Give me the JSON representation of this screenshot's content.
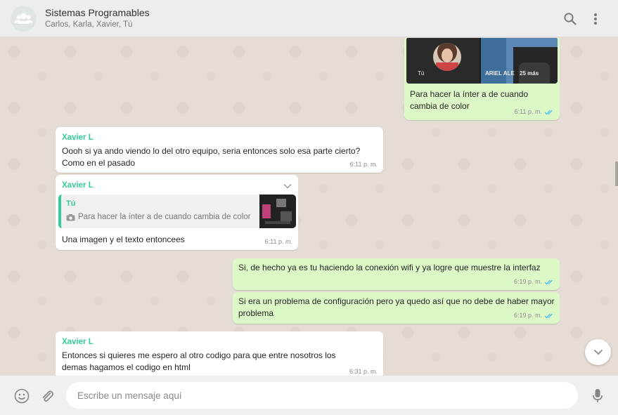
{
  "header": {
    "title": "Sistemas Programables",
    "members": "Carlos, Karla, Xavier, Tú"
  },
  "messages": {
    "m0": {
      "video_tiles": [
        "Tú",
        "ARIEL ALE",
        "25 más"
      ],
      "text": "Para hacer la ínter a de cuando cambia de color",
      "time": "6:11 p. m."
    },
    "m1": {
      "sender": "Xavier L",
      "text": "Oooh si ya ando viendo lo del otro equipo, seria entonces solo esa parte cierto? Como en el pasado",
      "time": "6:11 p. m."
    },
    "m2": {
      "sender": "Xavier L",
      "quote_author": "Tú",
      "quote_text": "Para hacer la ínter a de cuando cambia de color",
      "text": "Una imagen y el texto entoncees",
      "time": "6:11 p. m."
    },
    "m3": {
      "text": "Si, de hecho ya es tu haciendo la conexión wifi y ya logre que muestre la interfaz",
      "time": "6:19 p. m."
    },
    "m4": {
      "text": "Si era un problema de configuración pero ya quedo así que no debe de haber mayor problema",
      "time": "6:19 p. m."
    },
    "m5": {
      "sender": "Xavier L",
      "text": "Entonces si quieres me espero al otro codigo para que entre nosotros los demas hagamos el codigo en html",
      "time": "6:31 p. m."
    }
  },
  "composer": {
    "placeholder": "Escribe un mensaje aquí"
  },
  "colors": {
    "outgoing_bubble": "#dcf8c6",
    "incoming_bubble": "#ffffff",
    "sender_name": "#35cd96",
    "read_ticks": "#4fc3f7",
    "quote_bar": "#35cd96"
  },
  "icons": [
    "group-avatar-icon",
    "search-icon",
    "menu-icon",
    "chevron-down-icon",
    "double-check-icon",
    "camera-icon",
    "emoji-icon",
    "attach-icon",
    "mic-icon"
  ]
}
